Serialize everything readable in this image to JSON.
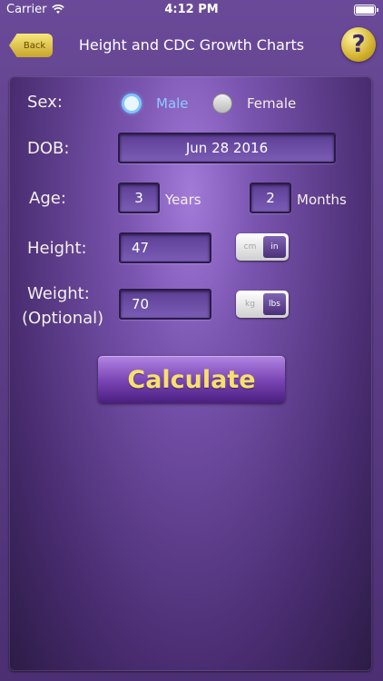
{
  "status_bar": {
    "carrier": "Carrier",
    "time": "4:12 PM"
  },
  "nav": {
    "back_label": "Back",
    "title": "Height and CDC Growth Charts",
    "help_symbol": "?"
  },
  "form": {
    "sex": {
      "label": "Sex:",
      "options": [
        "Male",
        "Female"
      ],
      "selected": "Male"
    },
    "dob": {
      "label": "DOB:",
      "value": "Jun 28 2016"
    },
    "age": {
      "label": "Age:",
      "years_value": "3",
      "years_label": "Years",
      "months_value": "2",
      "months_label": "Months"
    },
    "height": {
      "label": "Height:",
      "value": "47",
      "units": [
        "cm",
        "in"
      ],
      "selected_unit": "in"
    },
    "weight": {
      "label_line1": "Weight:",
      "label_line2": "(Optional)",
      "value": "70",
      "units": [
        "kg",
        "lbs"
      ],
      "selected_unit": "lbs"
    },
    "calculate_label": "Calculate"
  },
  "colors": {
    "accent_gold": "#f8e06e",
    "selected_radio_text": "#8fcaff",
    "panel_purple": "#7a55b0"
  }
}
